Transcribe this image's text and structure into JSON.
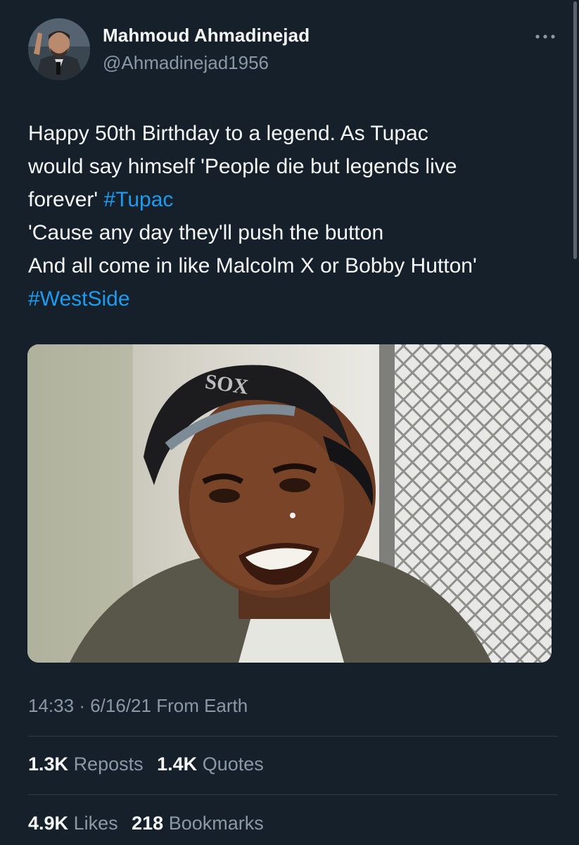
{
  "author": {
    "name": "Mahmoud Ahmadinejad",
    "handle": "@Ahmadinejad1956"
  },
  "tweet": {
    "line1": "Happy 50th Birthday to a legend. As Tupac",
    "line2": "would say himself 'People die but legends live",
    "line3_text": "forever' ",
    "hashtag1": "#Tupac",
    "line4": "'Cause any day they'll push the button",
    "line5": "And all come in like Malcolm X or Bobby Hutton'",
    "hashtag2": "#WestSide"
  },
  "media": {
    "cap_text": "SOX"
  },
  "meta": {
    "time": "14:33",
    "separator": "·",
    "date": "6/16/21",
    "source": "From Earth"
  },
  "stats": {
    "reposts_count": "1.3K",
    "reposts_label": "Reposts",
    "quotes_count": "1.4K",
    "quotes_label": "Quotes",
    "likes_count": "4.9K",
    "likes_label": "Likes",
    "bookmarks_count": "218",
    "bookmarks_label": "Bookmarks"
  },
  "colors": {
    "background": "#16202b",
    "hashtag": "#1d9bf0",
    "secondary_text": "#8b98a5"
  }
}
